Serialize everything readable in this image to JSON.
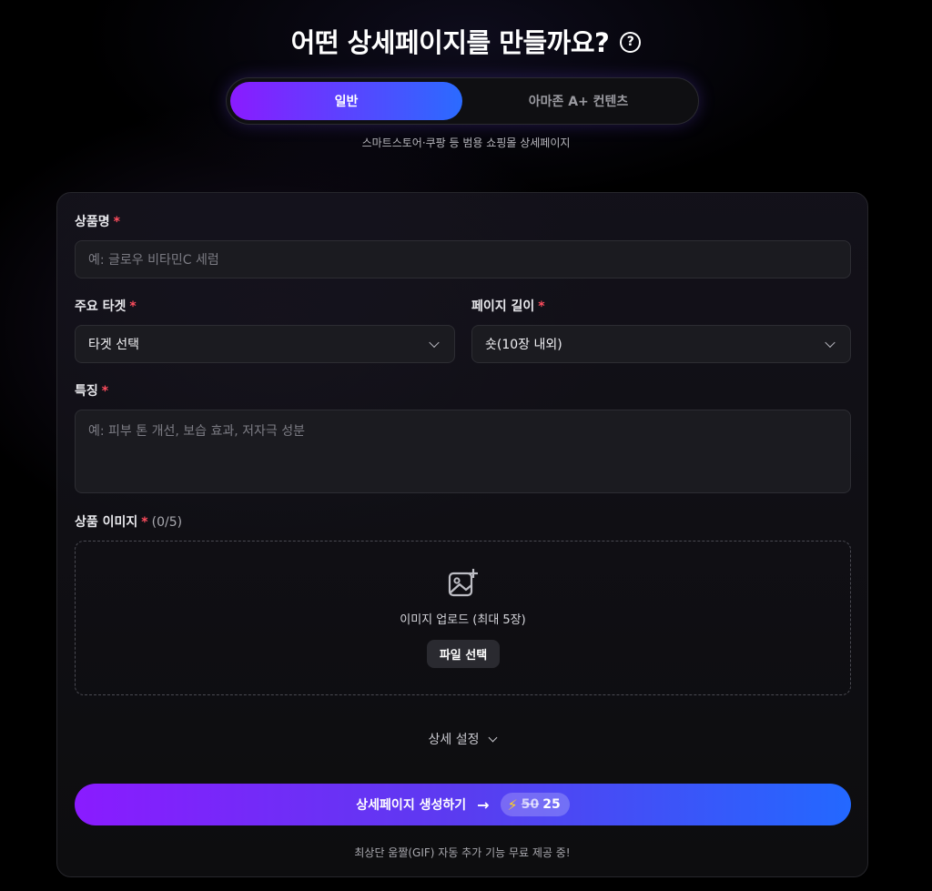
{
  "header": {
    "title": "어떤 상세페이지를 만들까요?",
    "help_icon": "question-circle-icon"
  },
  "mode_toggle": {
    "options": [
      "일반",
      "아마존 A+ 컨텐츠"
    ],
    "selected": "일반",
    "description": "스마트스토어·쿠팡 등 범용 쇼핑몰 상세페이지"
  },
  "form": {
    "product_name": {
      "label": "상품명",
      "required_mark": "*",
      "placeholder": "예: 글로우 비타민C 세럼"
    },
    "target": {
      "label": "주요 타겟",
      "required_mark": "*",
      "value": "타겟 선택"
    },
    "page_length": {
      "label": "페이지 길이",
      "required_mark": "*",
      "value": "숏(10장 내외)"
    },
    "features": {
      "label": "특징",
      "required_mark": "*",
      "placeholder": "예: 피부 톤 개선, 보습 효과, 저자극 성분"
    },
    "images": {
      "label": "상품 이미지",
      "required_mark": "*",
      "count": "(0/5)",
      "upload_text": "이미지 업로드 (최대 5장)",
      "file_button": "파일 선택",
      "icon": "image-add-icon"
    },
    "advanced_settings": "상세 설정"
  },
  "generate": {
    "label": "상세페이지 생성하기",
    "arrow": "→",
    "credit_old": "50",
    "credit_new": "25"
  },
  "footnote": "최상단 움짤(GIF) 자동 추가 기능 무료 제공 중!",
  "colors": {
    "accent_start": "#8a1bff",
    "accent_end": "#2368ff",
    "required": "#ff4d5e",
    "background": "#000000"
  }
}
